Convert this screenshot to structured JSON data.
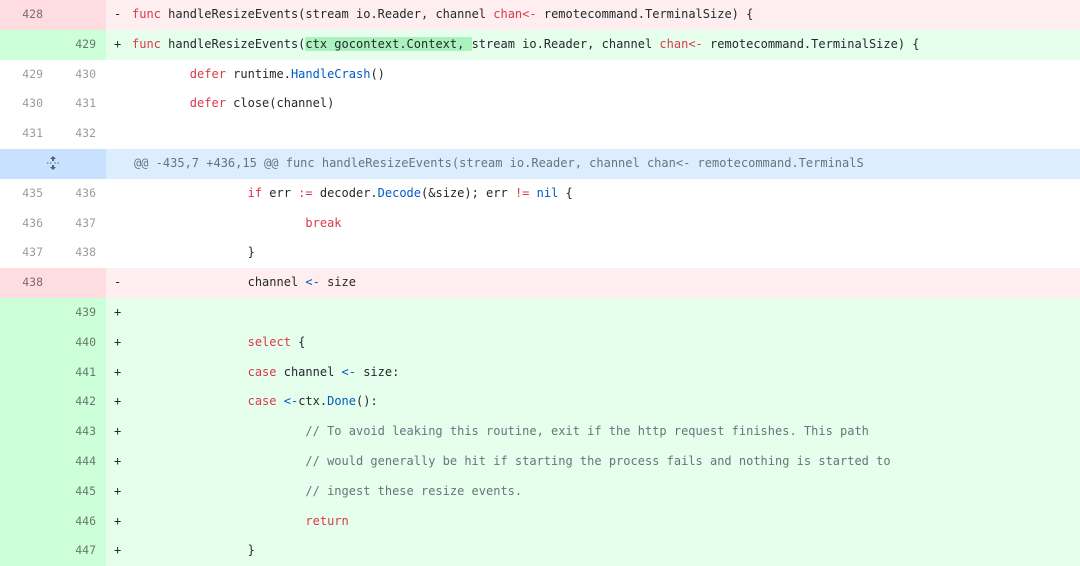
{
  "diff": {
    "rows": [
      {
        "type": "del",
        "old": "428",
        "new": "",
        "marker": "-"
      },
      {
        "type": "add",
        "old": "",
        "new": "429",
        "marker": "+"
      },
      {
        "type": "ctx",
        "old": "429",
        "new": "430",
        "marker": ""
      },
      {
        "type": "ctx",
        "old": "430",
        "new": "431",
        "marker": ""
      },
      {
        "type": "ctx",
        "old": "431",
        "new": "432",
        "marker": ""
      },
      {
        "type": "hunk",
        "text": "@@ -435,7 +436,15 @@ func handleResizeEvents(stream io.Reader, channel chan<- remotecommand.TerminalS"
      },
      {
        "type": "ctx",
        "old": "435",
        "new": "436",
        "marker": ""
      },
      {
        "type": "ctx",
        "old": "436",
        "new": "437",
        "marker": ""
      },
      {
        "type": "ctx",
        "old": "437",
        "new": "438",
        "marker": ""
      },
      {
        "type": "del",
        "old": "438",
        "new": "",
        "marker": "-"
      },
      {
        "type": "add",
        "old": "",
        "new": "439",
        "marker": "+"
      },
      {
        "type": "add",
        "old": "",
        "new": "440",
        "marker": "+"
      },
      {
        "type": "add",
        "old": "",
        "new": "441",
        "marker": "+"
      },
      {
        "type": "add",
        "old": "",
        "new": "442",
        "marker": "+"
      },
      {
        "type": "add",
        "old": "",
        "new": "443",
        "marker": "+"
      },
      {
        "type": "add",
        "old": "",
        "new": "444",
        "marker": "+"
      },
      {
        "type": "add",
        "old": "",
        "new": "445",
        "marker": "+"
      },
      {
        "type": "add",
        "old": "",
        "new": "446",
        "marker": "+"
      },
      {
        "type": "add",
        "old": "",
        "new": "447",
        "marker": "+"
      }
    ],
    "code": {
      "l0_a": "func handleResizeEvents(stream io.Reader, channel ",
      "l0_b": "chan",
      "l0_c": "<- ",
      "l0_d": "remotecommand.TerminalSize) {",
      "l1_a": "func handleResizeEvents(",
      "l1_hl": "ctx gocontext.Context, ",
      "l1_b": "stream io.Reader, channel ",
      "l1_c": "chan",
      "l1_d": "<- ",
      "l1_e": "remotecommand.TerminalSize) {",
      "l2_kw": "defer",
      "l2_a": " runtime.",
      "l2_fn": "HandleCrash",
      "l2_b": "()",
      "l3_kw": "defer",
      "l3_a": " close(channel)",
      "l6_kw": "if",
      "l6_a": " err ",
      "l6_op": ":=",
      "l6_b": " decoder.",
      "l6_fn": "Decode",
      "l6_c": "(&size); err ",
      "l6_op2": "!=",
      "l6_d": " ",
      "l6_nil": "nil",
      "l6_e": " {",
      "l7_kw": "break",
      "l8": "}",
      "l9_a": "channel ",
      "l9_op": "<-",
      "l9_b": " size",
      "l11_kw": "select",
      "l11_a": " {",
      "l12_kw": "case",
      "l12_a": " channel ",
      "l12_op": "<-",
      "l12_b": " size:",
      "l13_kw": "case",
      "l13_a": " ",
      "l13_op": "<-",
      "l13_b": "ctx.",
      "l13_fn": "Done",
      "l13_c": "():",
      "l14": "// To avoid leaking this routine, exit if the http request finishes. This path",
      "l15": "// would generally be hit if starting the process fails and nothing is started to",
      "l16": "// ingest these resize events.",
      "l17_kw": "return",
      "l18": "}"
    },
    "expand_icon": "expand-icon"
  }
}
